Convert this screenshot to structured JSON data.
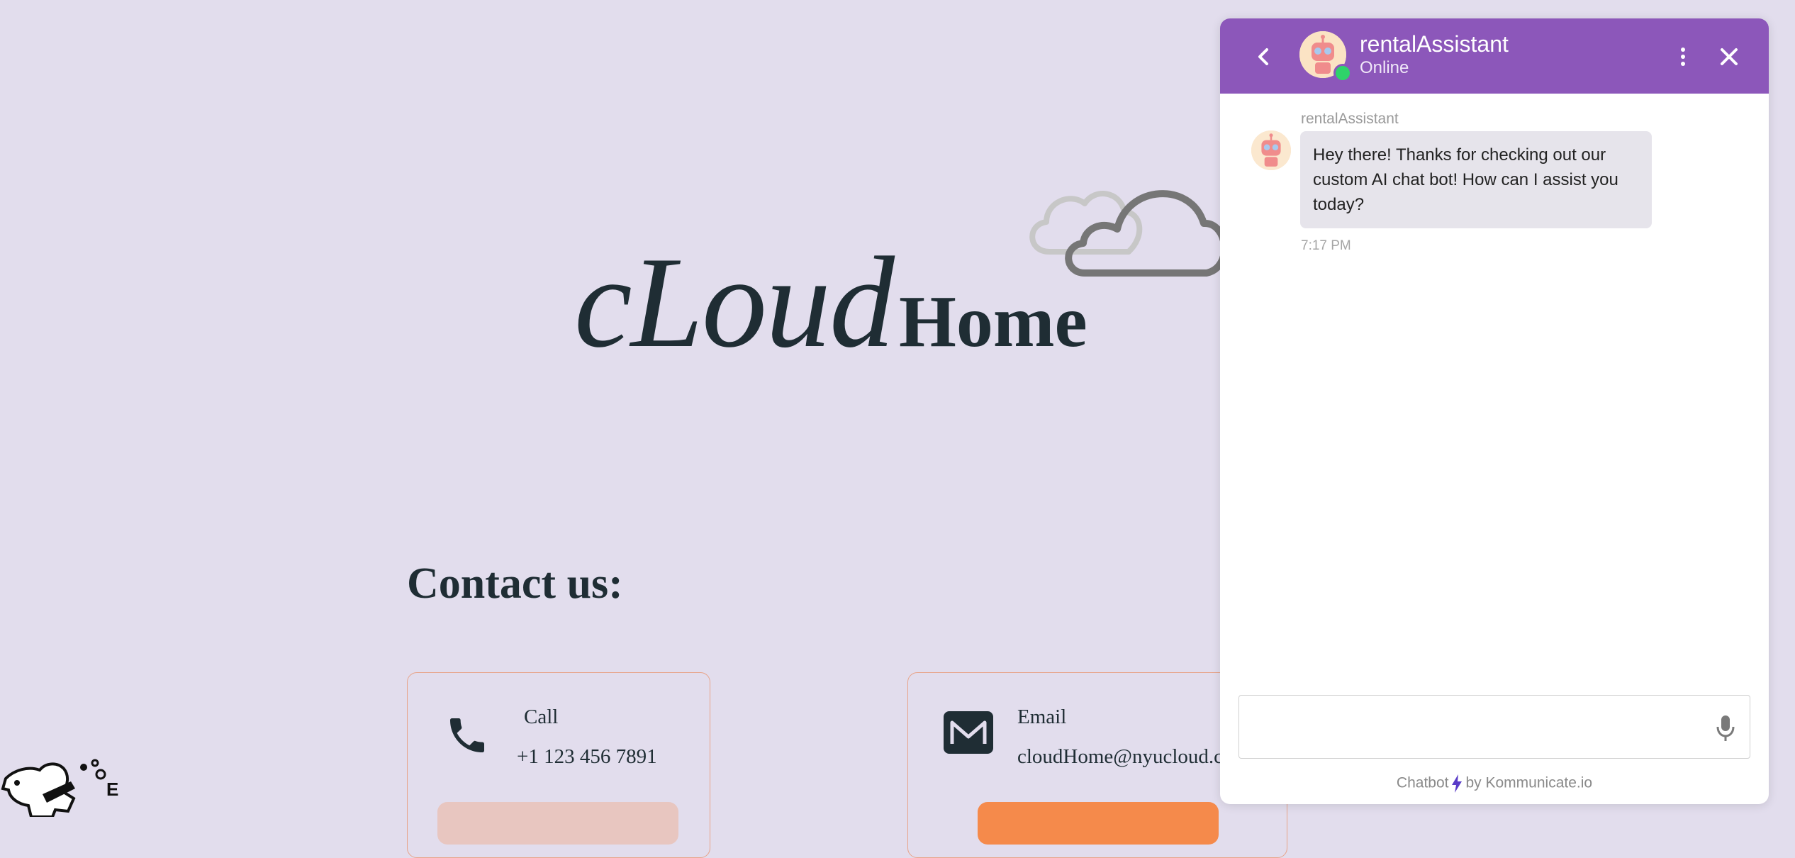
{
  "page": {
    "logo": {
      "part1": "cLoud",
      "part2": "Home"
    },
    "contact_title": "Contact us:",
    "call_card": {
      "label": "Call",
      "value": "+1 123 456 7891"
    },
    "email_card": {
      "label": "Email",
      "value": "cloudHome@nyucloud.co"
    }
  },
  "chat": {
    "header": {
      "name": "rentalAssistant",
      "status": "Online"
    },
    "messages": [
      {
        "sender": "rentalAssistant",
        "text": "Hey there! Thanks for checking out our custom AI chat bot! How can I assist you today?",
        "time": "7:17 PM"
      }
    ],
    "input": {
      "placeholder": ""
    },
    "footer": {
      "prefix": "Chatbot",
      "suffix": "by Kommunicate.io"
    }
  },
  "colors": {
    "background": "#e2dded",
    "header": "#8c57ba",
    "online": "#2fd36a",
    "accent_orange": "#f58a4b",
    "text_dark": "#1f2d34"
  },
  "icons": [
    "back-chevron-icon",
    "bot-avatar-icon",
    "more-vertical-icon",
    "close-icon",
    "microphone-icon",
    "bolt-icon",
    "phone-icon",
    "mail-icon",
    "cloud-icon"
  ]
}
